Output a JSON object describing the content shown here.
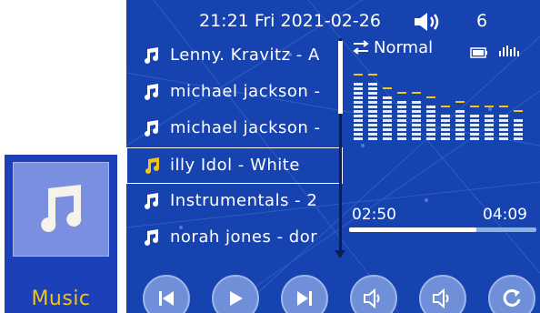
{
  "tile": {
    "label": "Music",
    "icon": "music-note-icon"
  },
  "status": {
    "time": "21:21",
    "day": "Fri",
    "date": "2021-02-26",
    "volume": "6",
    "volume_icon": "speaker-icon"
  },
  "playlist": {
    "items": [
      {
        "label": "Lenny. Kravitz - A"
      },
      {
        "label": "michael jackson -"
      },
      {
        "label": "michael jackson -"
      },
      {
        "label": "illy Idol - White"
      },
      {
        "label": "Instrumentals - 2"
      },
      {
        "label": "norah jones - dor"
      }
    ],
    "selected_index": 3
  },
  "player": {
    "mode": "Normal",
    "mode_icon": "repeat-icon",
    "battery_icon": "battery-icon",
    "eq_icon": "equalizer-icon",
    "elapsed": "02:50",
    "total": "04:09",
    "progress": 0.68
  },
  "equalizer": {
    "levels": [
      0.85,
      0.85,
      0.7,
      0.65,
      0.6,
      0.55,
      0.45,
      0.5,
      0.45,
      0.4,
      0.4,
      0.35
    ]
  },
  "controls": [
    {
      "icon": "previous-icon"
    },
    {
      "icon": "play-icon"
    },
    {
      "icon": "next-icon"
    },
    {
      "icon": "volume-down-icon"
    },
    {
      "icon": "volume-up-icon"
    },
    {
      "icon": "repeat-icon"
    }
  ],
  "colors": {
    "screen_bg": "#1743b0",
    "accent": "#f0c419",
    "eq_bar": "#e6ecf8",
    "eq_peak": "#f0c419"
  }
}
